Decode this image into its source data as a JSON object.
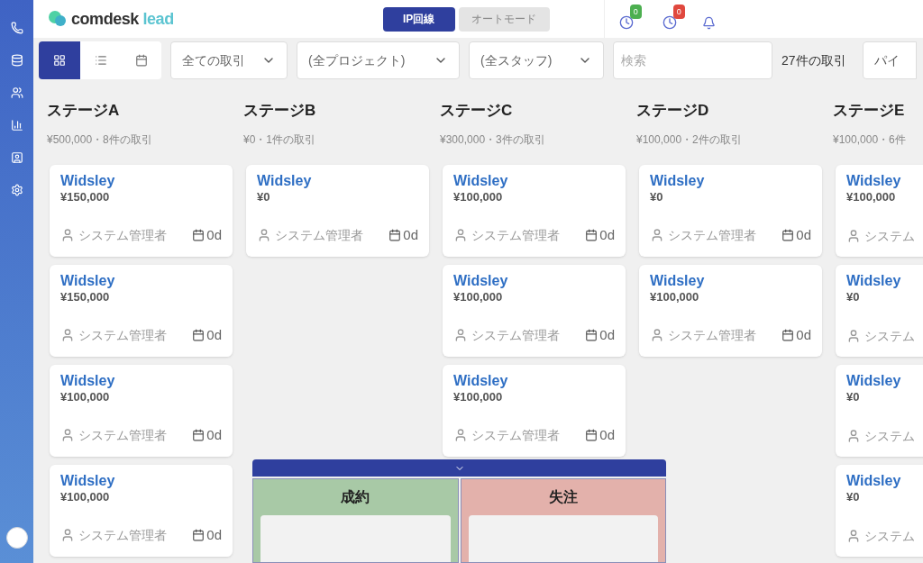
{
  "header": {
    "logo": {
      "main": "comdesk",
      "accent": "lead"
    },
    "modes": [
      {
        "label": "IP回線",
        "selected": true
      },
      {
        "label": "オートモード",
        "selected": false
      }
    ],
    "badges": [
      {
        "count": "0",
        "color": "#4caf50"
      },
      {
        "count": "0",
        "color": "#e0483e"
      }
    ]
  },
  "toolbar": {
    "views": [
      {
        "kind": "board",
        "selected": true
      },
      {
        "kind": "list",
        "selected": false
      },
      {
        "kind": "calendar",
        "selected": false
      }
    ],
    "filters": [
      "全ての取引",
      "(全プロジェクト)",
      "(全スタッフ)"
    ],
    "search": {
      "placeholder": "検索"
    },
    "count": "27件の取引",
    "pipeline": "パイ"
  },
  "columns": [
    {
      "title": "ステージA",
      "meta": "¥500,000・8件の取引",
      "cards": [
        {
          "name": "Widsley",
          "amount": "¥150,000",
          "owner": "システム管理者",
          "days": "0d"
        },
        {
          "name": "Widsley",
          "amount": "¥150,000",
          "owner": "システム管理者",
          "days": "0d"
        },
        {
          "name": "Widsley",
          "amount": "¥100,000",
          "owner": "システム管理者",
          "days": "0d"
        },
        {
          "name": "Widsley",
          "amount": "¥100,000",
          "owner": "システム管理者",
          "days": "0d"
        }
      ]
    },
    {
      "title": "ステージB",
      "meta": "¥0・1件の取引",
      "cards": [
        {
          "name": "Widsley",
          "amount": "¥0",
          "owner": "システム管理者",
          "days": "0d"
        }
      ]
    },
    {
      "title": "ステージC",
      "meta": "¥300,000・3件の取引",
      "cards": [
        {
          "name": "Widsley",
          "amount": "¥100,000",
          "owner": "システム管理者",
          "days": "0d"
        },
        {
          "name": "Widsley",
          "amount": "¥100,000",
          "owner": "システム管理者",
          "days": "0d"
        },
        {
          "name": "Widsley",
          "amount": "¥100,000",
          "owner": "システム管理者",
          "days": "0d"
        }
      ]
    },
    {
      "title": "ステージD",
      "meta": "¥100,000・2件の取引",
      "cards": [
        {
          "name": "Widsley",
          "amount": "¥0",
          "owner": "システム管理者",
          "days": "0d"
        },
        {
          "name": "Widsley",
          "amount": "¥100,000",
          "owner": "システム管理者",
          "days": "0d"
        }
      ]
    },
    {
      "title": "ステージE",
      "meta": "¥100,000・6件",
      "cards": [
        {
          "name": "Widsley",
          "amount": "¥100,000",
          "owner": "システム"
        },
        {
          "name": "Widsley",
          "amount": "¥0",
          "owner": "システム"
        },
        {
          "name": "Widsley",
          "amount": "¥0",
          "owner": "システム"
        },
        {
          "name": "Widsley",
          "amount": "¥0",
          "owner": "システム"
        }
      ]
    }
  ],
  "drop_zones": [
    {
      "label": "成約",
      "color": "#a8c9a6"
    },
    {
      "label": "失注",
      "color": "#e3b1ab"
    }
  ]
}
